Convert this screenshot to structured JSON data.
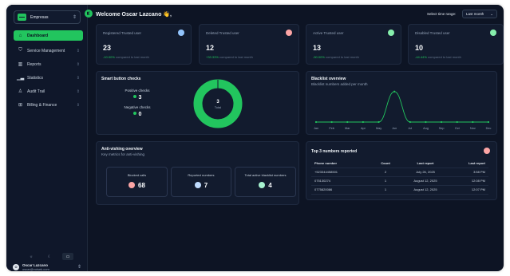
{
  "sidebar": {
    "org": "Empresas",
    "items": [
      {
        "label": "Dashboard",
        "icon": "home-icon",
        "glyph": "⌂",
        "active": true
      },
      {
        "label": "Service Management",
        "icon": "shield-icon",
        "glyph": "⛉",
        "active": false
      },
      {
        "label": "Reports",
        "icon": "building-icon",
        "glyph": "▥",
        "active": false
      },
      {
        "label": "Statistics",
        "icon": "chart-icon",
        "glyph": "▁▃",
        "active": false
      },
      {
        "label": "Audit Trail",
        "icon": "user-icon",
        "glyph": "♙",
        "active": false
      },
      {
        "label": "Billing & Finance",
        "icon": "grid-icon",
        "glyph": "⊞",
        "active": false
      }
    ],
    "theme_icons": [
      "sun-icon",
      "moon-icon",
      "monitor-icon"
    ],
    "user": {
      "name": "Oscar Lazcano",
      "email": "oscar@voisek.com",
      "initial": "O"
    }
  },
  "header": {
    "welcome": "Welcome Oscar Lazcano 👋,",
    "time_range_label": "Select time range:",
    "time_range_value": "Last month"
  },
  "stats": [
    {
      "title": "Registered Trusted user",
      "value": "23",
      "change": "-10.00%",
      "change_text": "compared to last month",
      "badge_color": "#93c5fd"
    },
    {
      "title": "Deleted Trusted user",
      "value": "12",
      "change": "+33.33%",
      "change_text": "compared to last month",
      "badge_color": "#fca5a5"
    },
    {
      "title": "Active Trusted user",
      "value": "13",
      "change": "-50.00%",
      "change_text": "compared to last month",
      "badge_color": "#86efac"
    },
    {
      "title": "Disabled Trusted user",
      "value": "10",
      "change": "-44.44%",
      "change_text": "compared to last month",
      "badge_color": "#86efac"
    }
  ],
  "smart_checks": {
    "title": "Smart button checks",
    "positive_label": "Positive checks",
    "positive_value": "3",
    "negative_label": "Negative checks",
    "negative_value": "0",
    "donut_total": "3",
    "donut_label": "Total",
    "positive_color": "#22c55e",
    "negative_color": "#4b5563"
  },
  "blacklist": {
    "title": "Blacklist overview",
    "subtitle": "Blacklist numbers added per month"
  },
  "chart_data": {
    "type": "line",
    "title": "Blacklist overview",
    "subtitle": "Blacklist numbers added per month",
    "categories": [
      "Jan",
      "Feb",
      "Mar",
      "Apr",
      "May",
      "Jun",
      "Jul",
      "Aug",
      "Sep",
      "Oct",
      "Nov",
      "Dec"
    ],
    "series": [
      {
        "values": [
          0,
          0,
          0,
          0,
          0,
          4,
          0,
          0,
          0,
          0,
          0,
          0
        ]
      }
    ],
    "ylim": [
      0,
      4.5
    ],
    "color": "#22c55e",
    "grid": false
  },
  "anti_vishing": {
    "title": "Anti-vishing overview",
    "subtitle": "Key metrics for anti-vishing",
    "metrics": [
      {
        "label": "Blocked calls",
        "value": "68",
        "icon": "block-icon",
        "color": "#fca5a5"
      },
      {
        "label": "Reported numbers",
        "value": "7",
        "icon": "flag-icon",
        "color": "#bfdbfe"
      },
      {
        "label": "Total active blacklist numbers",
        "value": "4",
        "icon": "list-icon",
        "color": "#a7f3d0"
      }
    ]
  },
  "top_reported": {
    "title": "Top 3 numbers reported",
    "headers": [
      "Phone number",
      "Count",
      "Last report",
      "Last report"
    ],
    "rows": [
      [
        "+523344458501",
        "2",
        "July 26, 2025",
        "3:58 PM"
      ],
      [
        "075130274",
        "1",
        "August 12, 2025",
        "12:08 PM"
      ],
      [
        "0775820086",
        "1",
        "August 12, 2025",
        "12:07 PM"
      ]
    ]
  }
}
